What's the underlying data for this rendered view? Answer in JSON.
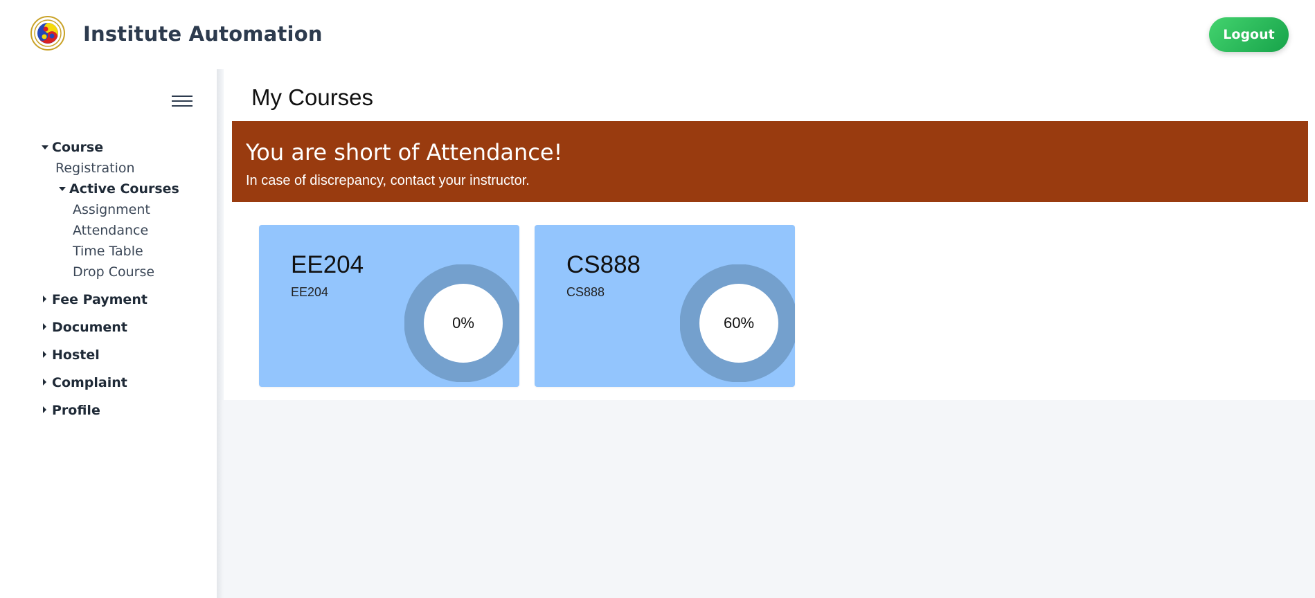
{
  "header": {
    "title": "Institute Automation",
    "logout_label": "Logout",
    "logo_icon": "institute-emblem-icon"
  },
  "sidebar": {
    "menu_icon": "hamburger-icon",
    "items": [
      {
        "label": "Course",
        "expanded": true
      },
      {
        "label": "Registration"
      },
      {
        "label": "Active Courses",
        "expanded": true
      },
      {
        "label": "Assignment"
      },
      {
        "label": "Attendance"
      },
      {
        "label": "Time Table"
      },
      {
        "label": "Drop Course"
      },
      {
        "label": "Fee Payment",
        "expanded": false
      },
      {
        "label": "Document",
        "expanded": false
      },
      {
        "label": "Hostel",
        "expanded": false
      },
      {
        "label": "Complaint",
        "expanded": false
      },
      {
        "label": "Profile",
        "expanded": false
      }
    ]
  },
  "main": {
    "title": "My Courses",
    "alert": {
      "title": "You are short of Attendance!",
      "message": "In case of discrepancy, contact your instructor.",
      "color": "#993b0f"
    },
    "courses": [
      {
        "code": "EE204",
        "name": "EE204",
        "attendance_label": "0%",
        "attendance": 0
      },
      {
        "code": "CS888",
        "name": "CS888",
        "attendance_label": "60%",
        "attendance": 60
      }
    ]
  },
  "colors": {
    "card": "#93c5fd",
    "ring": "#74a0cd",
    "logout_start": "#43d36e",
    "logout_end": "#17a34a"
  }
}
